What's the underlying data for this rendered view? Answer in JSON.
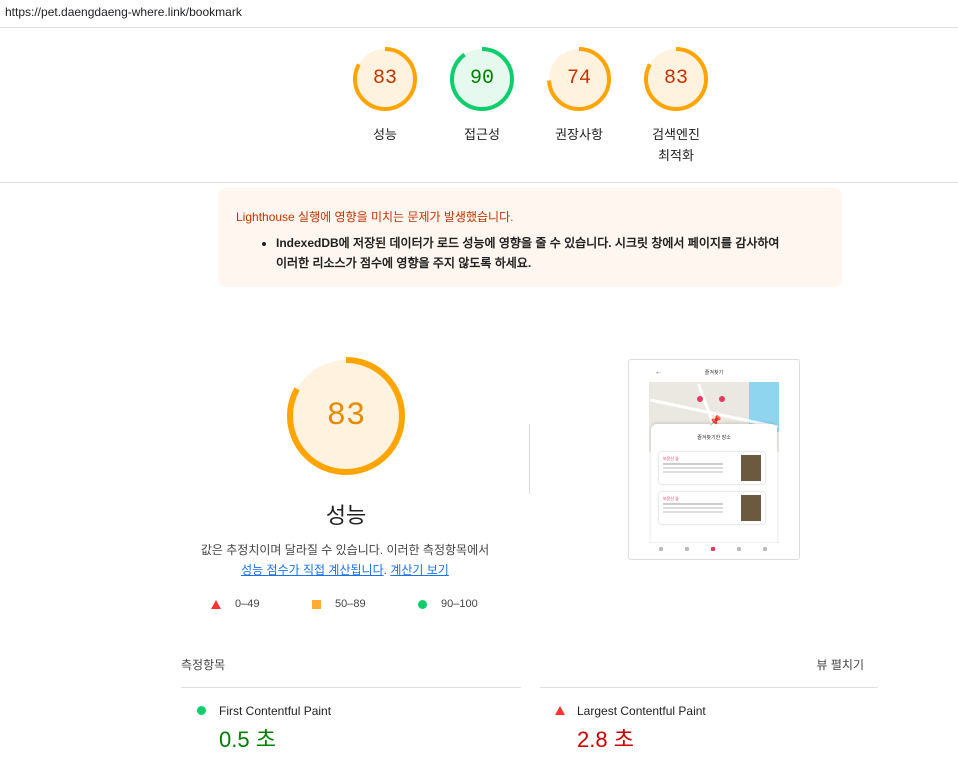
{
  "url": "https://pet.daengdaeng-where.link/bookmark",
  "colors": {
    "good": "#0cce6b",
    "average": "#ffa400",
    "poor": "#ff3333",
    "average_text": "#c33300",
    "good_text": "#008000"
  },
  "gauges": [
    {
      "score": 83,
      "label": "성능",
      "rating": "average"
    },
    {
      "score": 90,
      "label": "접근성",
      "rating": "good"
    },
    {
      "score": 74,
      "label": "권장사항",
      "rating": "average"
    },
    {
      "score": 83,
      "label_line1": "검색엔진",
      "label_line2": "최적화",
      "rating": "average"
    }
  ],
  "warning": {
    "title": "Lighthouse 실행에 영향을 미치는 문제가 발생했습니다.",
    "item_line1": "IndexedDB에 저장된 데이터가 로드 성능에 영향을 줄 수 있습니다. 시크릿 창에서 페이지를 감사하여",
    "item_line2": "이러한 리소스가 점수에 영향을 주지 않도록 하세요."
  },
  "performance": {
    "score": 83,
    "title": "성능",
    "desc_line1": "값은 추정치이며 달라질 수 있습니다. 이러한 측정항목에서",
    "link_calc": "성능 점수가 직접 계산됩니다",
    "period": ".",
    "link_calculator": "계산기 보기"
  },
  "legend": [
    {
      "icon": "triangle-icon",
      "range": "0–49"
    },
    {
      "icon": "square-icon",
      "range": "50–89"
    },
    {
      "icon": "circle-icon",
      "range": "90–100"
    }
  ],
  "screenshot": {
    "header": "즐겨찾기",
    "sheet_title": "즐겨찾기한 장소",
    "card1_title": "보문산 숲",
    "card2_title": "보문산 숲"
  },
  "metrics_header": {
    "title": "측정항목",
    "expand": "뷰 펼치기"
  },
  "metrics": [
    {
      "name": "First Contentful Paint",
      "value": "0.5 초",
      "rating": "good"
    },
    {
      "name": "Largest Contentful Paint",
      "value": "2.8 초",
      "rating": "poor"
    }
  ]
}
